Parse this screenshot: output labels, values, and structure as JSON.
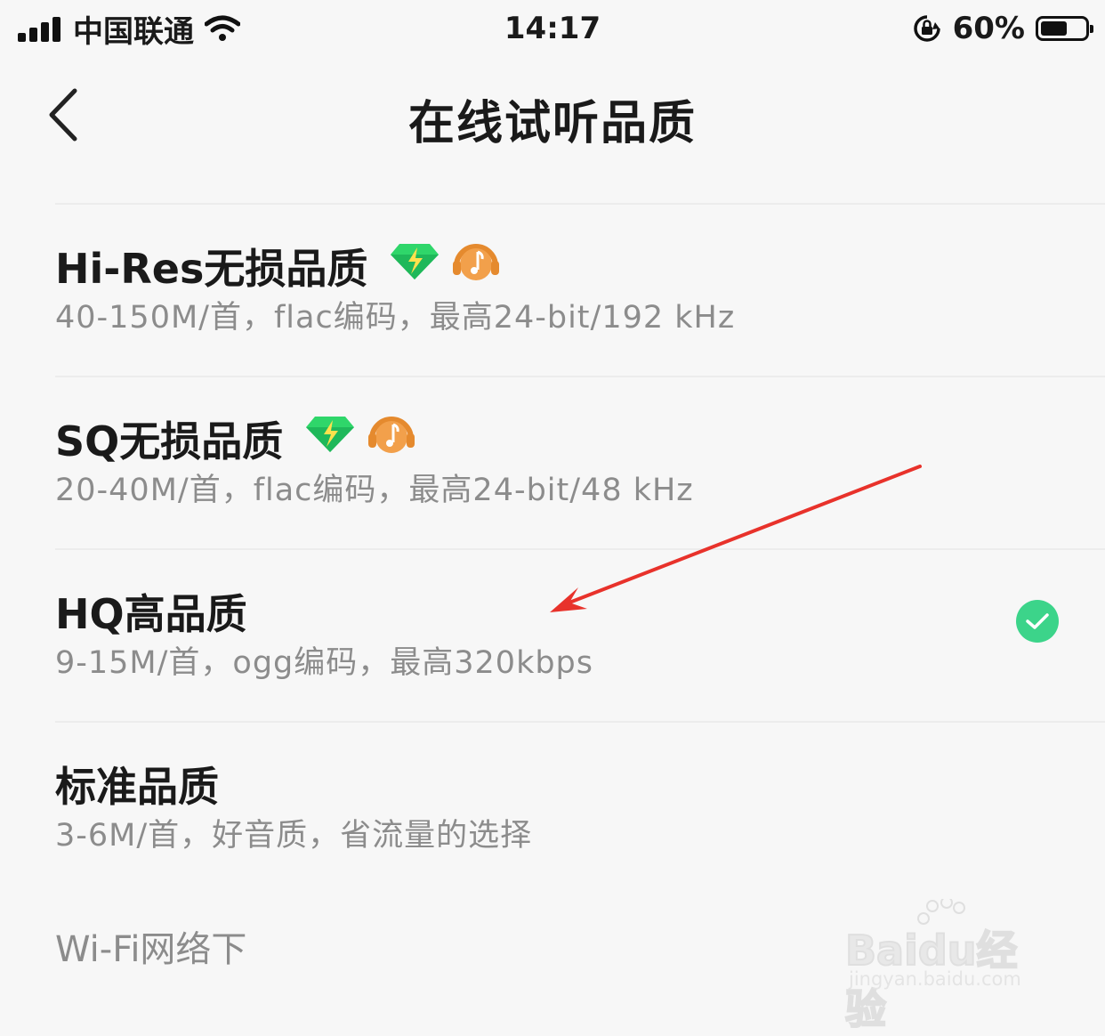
{
  "status_bar": {
    "carrier": "中国联通",
    "time": "14:17",
    "battery_percent": "60%",
    "battery_level": 0.6
  },
  "header": {
    "title": "在线试听品质",
    "back_icon": "chevron-left-icon"
  },
  "options": [
    {
      "title": "Hi-Res无损品质",
      "description": "40-150M/首，flac编码，最高24-bit/192 kHz",
      "badges": [
        "diamond-icon",
        "music-headphone-icon"
      ],
      "selected": false
    },
    {
      "title": "SQ无损品质",
      "description": "20-40M/首，flac编码，最高24-bit/48 kHz",
      "badges": [
        "diamond-icon",
        "music-headphone-icon"
      ],
      "selected": false
    },
    {
      "title": "HQ高品质",
      "description": "9-15M/首，ogg编码，最高320kbps",
      "badges": [],
      "selected": true
    },
    {
      "title": "标准品质",
      "description": "3-6M/首，好音质，省流量的选择",
      "badges": [],
      "selected": false
    }
  ],
  "section_label": "Wi-Fi网络下",
  "colors": {
    "background": "#f7f7f7",
    "check_green": "#3cd48a",
    "diamond_green": "#2fd66a",
    "badge_orange": "#f2a04b",
    "annotation_arrow": "#e8322b"
  },
  "watermark": {
    "brand": "Baidu经验",
    "url": "jingyan.baidu.com"
  }
}
